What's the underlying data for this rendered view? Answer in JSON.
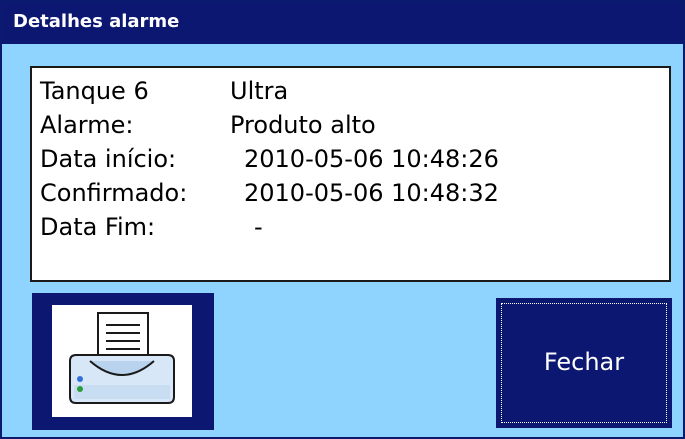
{
  "window": {
    "title": "Detalhes alarme"
  },
  "details": {
    "tank_label": "Tanque 6",
    "tank_value": "Ultra",
    "alarm_label": "Alarme:",
    "alarm_value": "Produto alto",
    "start_label": "Data início:",
    "start_value": "2010-05-06 10:48:26",
    "confirmed_label": "Confirmado:",
    "confirmed_value": "2010-05-06 10:48:32",
    "end_label": "Data Fim:",
    "end_value": "-"
  },
  "buttons": {
    "print_icon": "printer-icon",
    "close_label": "Fechar"
  },
  "colors": {
    "titlebar": "#0c1772",
    "background": "#8fd3ff",
    "button": "#0c1772"
  }
}
